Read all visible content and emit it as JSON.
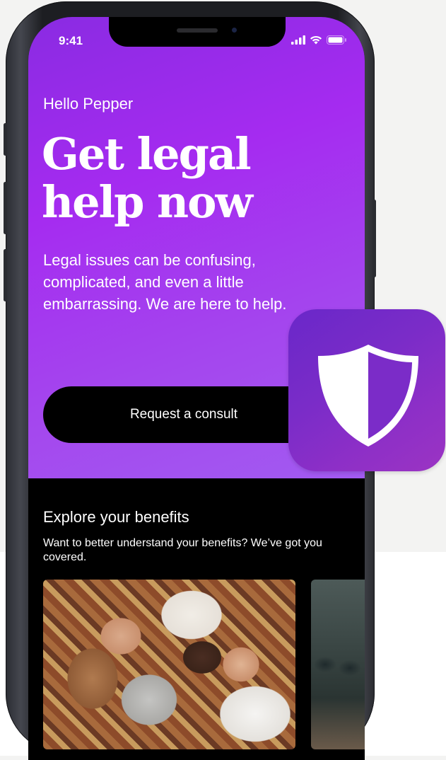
{
  "status_bar": {
    "time": "9:41",
    "icons": [
      "cellular-signal-icon",
      "wifi-icon",
      "battery-icon"
    ]
  },
  "hero": {
    "greeting": "Hello Pepper",
    "headline_line1": "Get legal",
    "headline_line2": "help now",
    "subtitle": "Legal issues can be confusing, complicated, and even a little embarrassing. We are here to help.",
    "cta_label": "Request a consult"
  },
  "benefits": {
    "title": "Explore your benefits",
    "description": "Want to better understand your benefits? We’ve got you covered.",
    "cards": [
      "family-photo",
      "dark-interior-photo"
    ]
  },
  "app_icon": {
    "icon": "shield-icon"
  },
  "colors": {
    "hero_gradient_start": "#8a2be2",
    "hero_gradient_end": "#a25bf1",
    "app_icon": "#7a2cc8",
    "cta_background": "#000000",
    "text": "#ffffff"
  }
}
